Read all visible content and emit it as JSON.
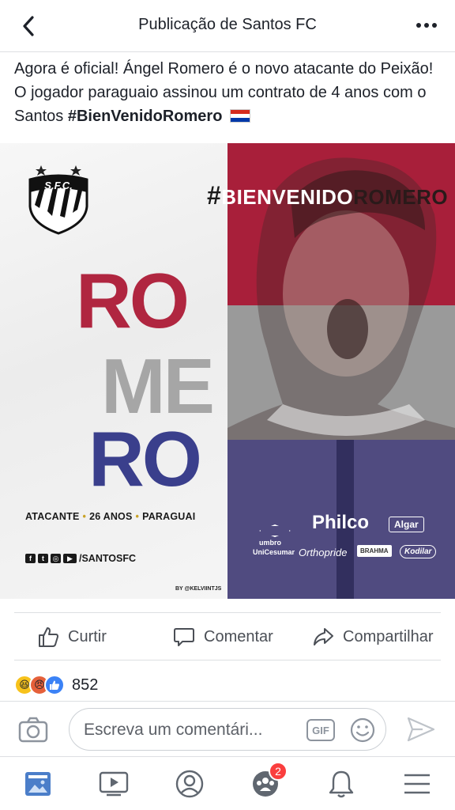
{
  "header": {
    "title": "Publicação de Santos FC",
    "back_icon": "chevron-left-icon",
    "more_icon": "more-dots-icon"
  },
  "post": {
    "text_main": "Agora é oficial! Ángel Romero é o novo atacante do Peixão! O jogador paraguaio assinou um contrato de 4 anos com o Santos ",
    "hashtag": "#BienVenidoRomero",
    "flag_icon": "paraguay-flag-icon"
  },
  "image": {
    "hashtag_prefix": "#",
    "hashtag_part1": "BIENVENIDO",
    "hashtag_part2": "ROMERO",
    "name_row1": "RO",
    "name_row2": "ME",
    "name_row3": "RO",
    "info": {
      "position": "ATACANTE",
      "age": "26 ANOS",
      "country": "PARAGUAI"
    },
    "social_handle": "/SANTOSFC",
    "credit": "BY @KELVIINTJS",
    "sponsors": {
      "umbro": "umbro",
      "philco": "Philco",
      "algar": "Algar",
      "unicesumar": "UniCesumar",
      "orthopride": "Orthopride",
      "brahma": "BRAHMA",
      "kodilar": "Kodilar"
    },
    "colors": {
      "red": "#a81f3a",
      "gray": "#9a9a9a",
      "blue": "#5b5fb0"
    }
  },
  "actions": {
    "like": "Curtir",
    "comment": "Comentar",
    "share": "Compartilhar"
  },
  "reactions": {
    "count": "852",
    "types": [
      "haha",
      "angry",
      "like"
    ]
  },
  "comment_bar": {
    "placeholder": "Escreva um comentári...",
    "gif_label": "GIF"
  },
  "bottom_nav": {
    "items": [
      "news-feed-icon",
      "watch-icon",
      "profile-icon",
      "groups-icon",
      "notifications-icon",
      "menu-icon"
    ],
    "groups_badge": "2"
  }
}
